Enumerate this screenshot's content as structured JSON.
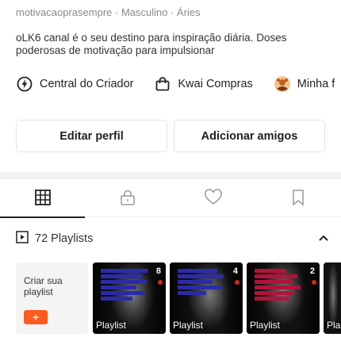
{
  "profile": {
    "meta_line": "motivacaoprasempre · Masculino · Áries",
    "bio": "oLK6  canal  é o seu destino para inspiração diária. Doses poderosas de motivação para impulsionar"
  },
  "shortcuts": [
    {
      "label": "Central do Criador",
      "icon": "lightning-circle-icon"
    },
    {
      "label": "Kwai Compras",
      "icon": "shopping-bag-icon"
    },
    {
      "label": "Minha f",
      "icon": "avatar-icon"
    }
  ],
  "buttons": {
    "edit_profile": "Editar perfil",
    "add_friends": "Adicionar amigos"
  },
  "tabs": [
    {
      "name": "grid",
      "icon": "grid-icon",
      "active": true
    },
    {
      "name": "private",
      "icon": "lock-icon",
      "active": false
    },
    {
      "name": "liked",
      "icon": "heart-icon",
      "active": false
    },
    {
      "name": "saved",
      "icon": "bookmark-icon",
      "active": false
    }
  ],
  "playlists": {
    "count_label": "72 Playlists",
    "create_label": "Criar sua playlist",
    "create_button": "+",
    "items": [
      {
        "label": "Playlist",
        "count": "8"
      },
      {
        "label": "Playlist",
        "count": "4"
      },
      {
        "label": "Playlist",
        "count": "2"
      },
      {
        "label": "Pla",
        "count": ""
      }
    ]
  },
  "colors": {
    "accent": "#ff5a1f",
    "text_muted": "#8a8a8a"
  }
}
